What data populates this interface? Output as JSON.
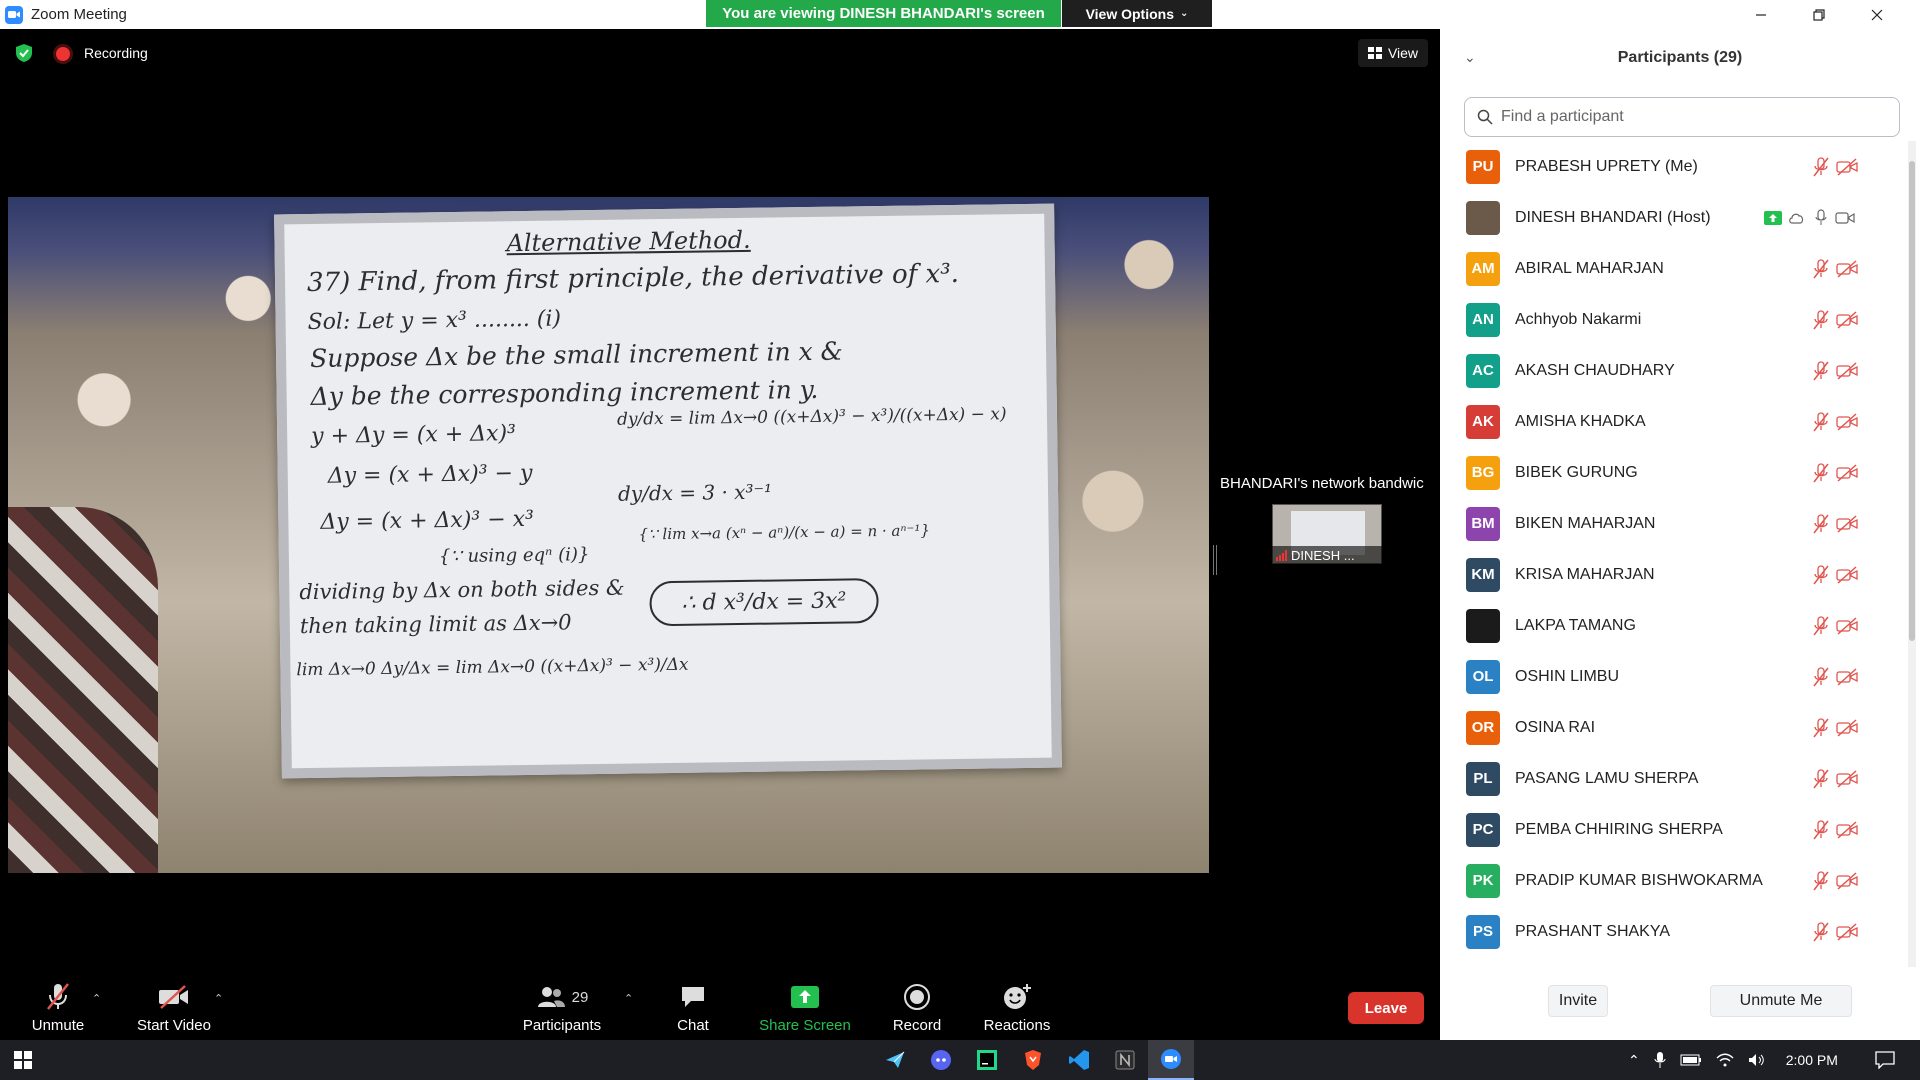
{
  "window": {
    "title": "Zoom Meeting",
    "viewing_banner": "You are viewing DINESH BHANDARI's screen",
    "view_options": "View Options"
  },
  "meeting": {
    "recording_label": "Recording",
    "view_button": "View",
    "thumbnail_notice": "BHANDARI's network bandwic",
    "thumbnail_name": "DINESH ..."
  },
  "whiteboard": {
    "lines": [
      "Alternative Method.",
      "37) Find, from first principle, the derivative of x³.",
      "Sol: Let y = x³ ........ (i)",
      "Suppose Δx be the small increment in x &",
      "Δy be the corresponding increment in y.",
      "y + Δy = (x + Δx)³",
      "Δy = (x + Δx)³ − y",
      "Δy = (x + Δx)³ − x³",
      "{∵ using eqⁿ (i)}",
      "dividing by Δx on both sides &",
      "then taking limit as Δx→0",
      "lim Δx→0 Δy/Δx = lim Δx→0 ((x+Δx)³ − x³)/Δx",
      "dy/dx = lim Δx→0 ((x+Δx)³ − x³)/((x+Δx) − x)",
      "dy/dx = 3 · x³⁻¹",
      "{∵ lim x→a (xⁿ − aⁿ)/(x − a) = n · aⁿ⁻¹}",
      "∴ d x³/dx = 3x²"
    ]
  },
  "toolbar": {
    "unmute": "Unmute",
    "start_video": "Start Video",
    "participants": "Participants",
    "participants_count": "29",
    "chat": "Chat",
    "share_screen": "Share Screen",
    "record": "Record",
    "reactions": "Reactions",
    "leave": "Leave"
  },
  "panel": {
    "title": "Participants (29)",
    "search_placeholder": "Find a participant",
    "invite": "Invite",
    "unmute_me": "Unmute Me",
    "participants": [
      {
        "initials": "PU",
        "name": "PRABESH UPRETY (Me)",
        "color": "#e8610a"
      },
      {
        "initials": "",
        "name": "DINESH BHANDARI (Host)",
        "color": "#6b5a4a"
      },
      {
        "initials": "AM",
        "name": "ABIRAL MAHARJAN",
        "color": "#f5a10f"
      },
      {
        "initials": "AN",
        "name": "Achhyob Nakarmi",
        "color": "#12a08a"
      },
      {
        "initials": "AC",
        "name": "AKASH CHAUDHARY",
        "color": "#12a08a"
      },
      {
        "initials": "AK",
        "name": "AMISHA KHADKA",
        "color": "#d63d36"
      },
      {
        "initials": "BG",
        "name": "BIBEK GURUNG",
        "color": "#f5a10f"
      },
      {
        "initials": "BM",
        "name": "BIKEN MAHARJAN",
        "color": "#8e44ad"
      },
      {
        "initials": "KM",
        "name": "KRISA MAHARJAN",
        "color": "#2f4a63"
      },
      {
        "initials": "",
        "name": "LAKPA TAMANG",
        "color": "#1b1b1b"
      },
      {
        "initials": "OL",
        "name": "OSHIN LIMBU",
        "color": "#2a82c4"
      },
      {
        "initials": "OR",
        "name": "OSINA RAI",
        "color": "#e8610a"
      },
      {
        "initials": "PL",
        "name": "PASANG LAMU SHERPA",
        "color": "#2f4a63"
      },
      {
        "initials": "PC",
        "name": "PEMBA CHHIRING SHERPA",
        "color": "#2f4a63"
      },
      {
        "initials": "PK",
        "name": "PRADIP KUMAR BISHWOKARMA",
        "color": "#27ae60"
      },
      {
        "initials": "PS",
        "name": "PRASHANT SHAKYA",
        "color": "#2a82c4"
      }
    ]
  },
  "taskbar": {
    "time": "2:00 PM"
  },
  "colors": {
    "banner_green": "#23a94a",
    "leave_red": "#d9342b",
    "share_green": "#23c050",
    "muted_red": "#e0554e"
  }
}
